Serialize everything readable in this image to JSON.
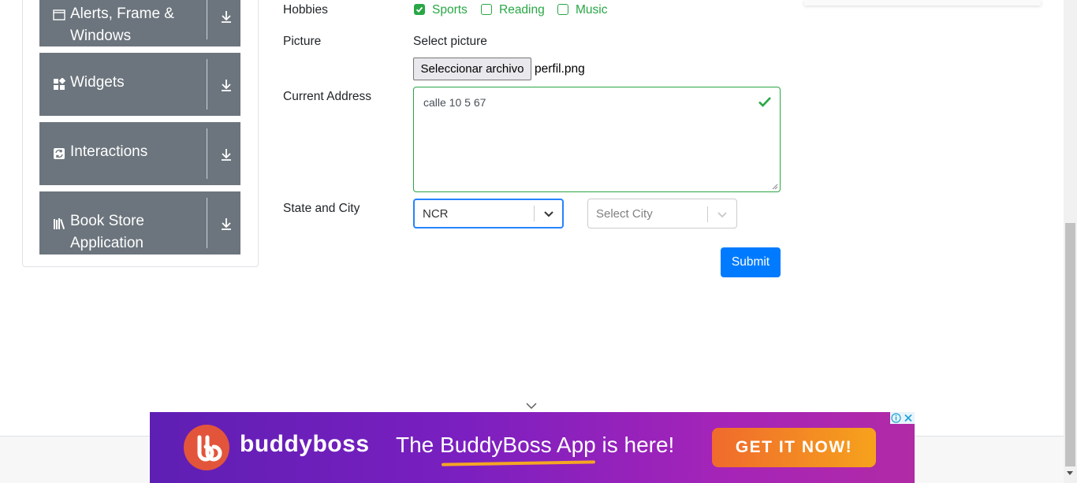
{
  "sidebar": {
    "groups": [
      {
        "label": "Alerts, Frame & Windows",
        "icon": "window-icon"
      },
      {
        "label": "Widgets",
        "icon": "widgets-icon"
      },
      {
        "label": "Interactions",
        "icon": "interactions-icon"
      },
      {
        "label": "Book Store Application",
        "icon": "books-icon"
      }
    ],
    "download_icon": "download-icon"
  },
  "form": {
    "hobbies": {
      "label": "Hobbies",
      "options": [
        {
          "label": "Sports",
          "checked": true
        },
        {
          "label": "Reading",
          "checked": false
        },
        {
          "label": "Music",
          "checked": false
        }
      ]
    },
    "picture": {
      "label": "Picture",
      "hint": "Select picture",
      "button_label": "Seleccionar archivo",
      "file_name": "perfil.png"
    },
    "address": {
      "label": "Current Address",
      "value": "calle 10 5 67",
      "valid": true
    },
    "state_city": {
      "label": "State and City",
      "state_value": "NCR",
      "city_placeholder": "Select City"
    },
    "submit_label": "Submit"
  },
  "banner": {
    "brand": "buddyboss",
    "headline": "The BuddyBoss App is here!",
    "cta": "GET IT NOW!"
  },
  "colors": {
    "sidebar_bg": "#6c757d",
    "valid_green": "#28a745",
    "primary_blue": "#007bff",
    "banner_purple": "#7a1fc0",
    "cta_orange": "#f39020"
  }
}
